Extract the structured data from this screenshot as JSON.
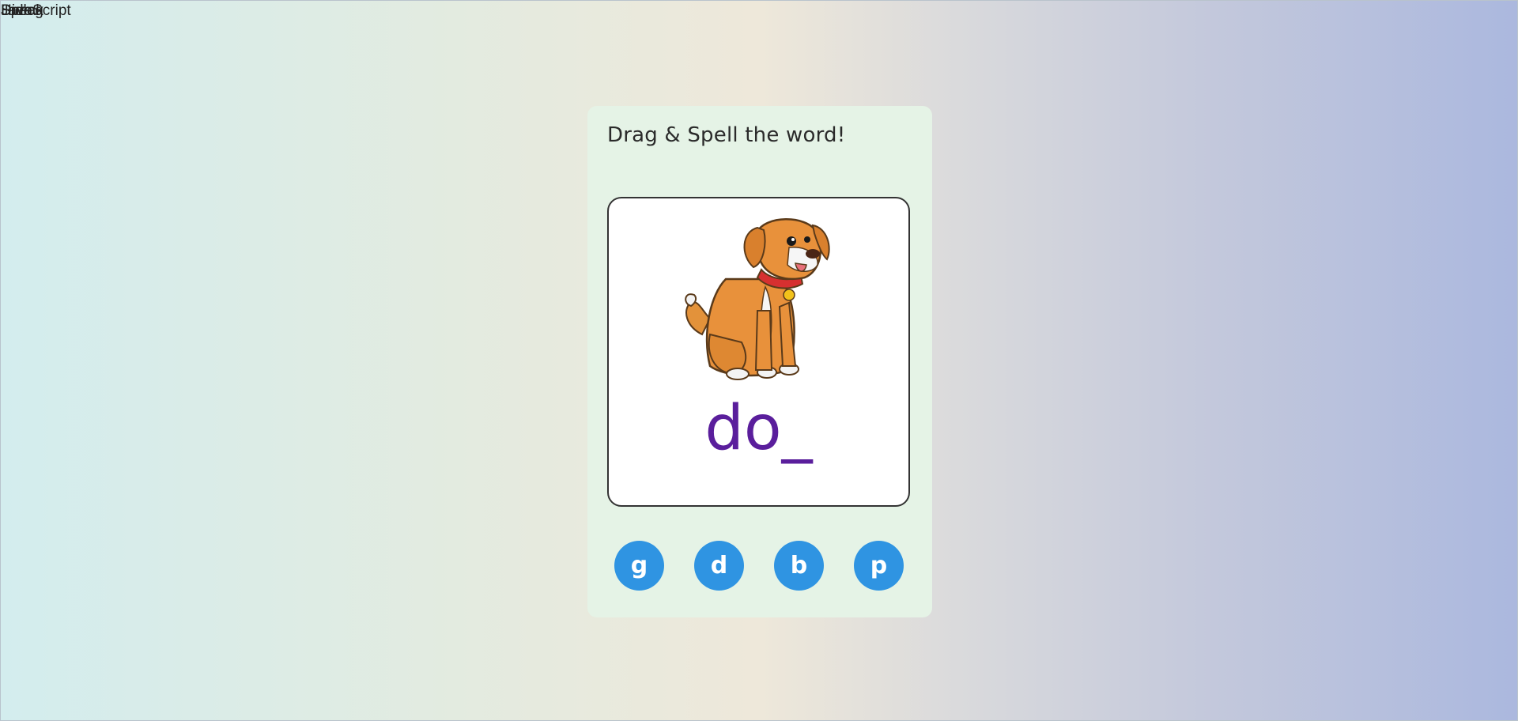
{
  "overlap_labels": [
    "Hide",
    "Speak",
    "JavaScript",
    "Dialog"
  ],
  "card": {
    "title": "Drag & Spell the word!",
    "image_icon": "dog-illustration",
    "word_display": "do_"
  },
  "letter_tiles": [
    "g",
    "d",
    "b",
    "p"
  ],
  "colors": {
    "card_bg": "#e5f3e6",
    "word": "#5a1e9c",
    "tile": "#2f94e2"
  }
}
